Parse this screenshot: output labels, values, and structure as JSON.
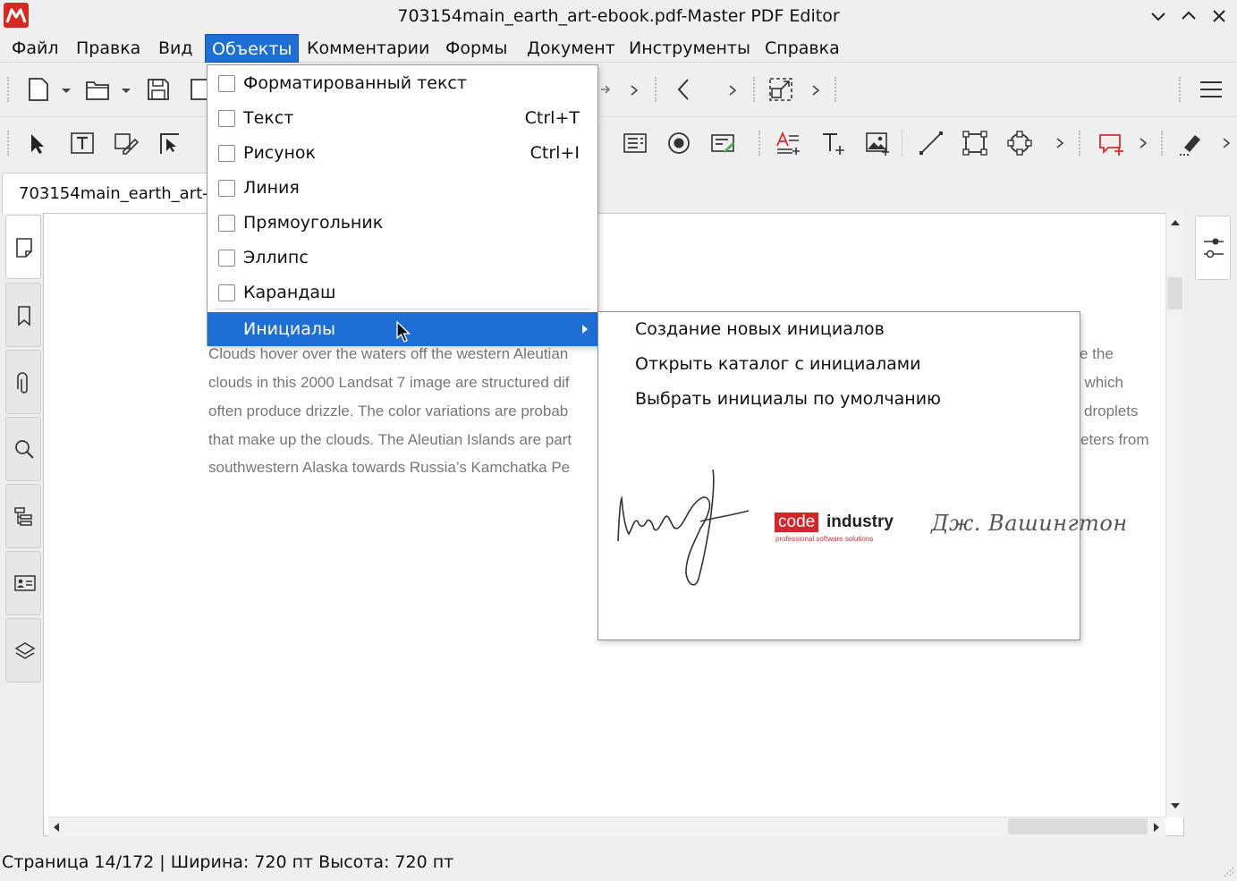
{
  "window": {
    "title": "703154main_earth_art-ebook.pdf-Master PDF Editor"
  },
  "menubar": {
    "items": [
      "Файл",
      "Правка",
      "Вид",
      "Объекты",
      "Комментарии",
      "Формы",
      "Документ",
      "Инструменты",
      "Справка"
    ],
    "active": "Объекты"
  },
  "tab": {
    "label": "703154main_earth_art-"
  },
  "objects_menu": {
    "items": [
      {
        "label": "Форматированный текст",
        "shortcut": ""
      },
      {
        "label": "Текст",
        "shortcut": "Ctrl+T"
      },
      {
        "label": "Рисунок",
        "shortcut": "Ctrl+I"
      },
      {
        "label": "Линия",
        "shortcut": ""
      },
      {
        "label": "Прямоугольник",
        "shortcut": ""
      },
      {
        "label": "Эллипс",
        "shortcut": ""
      },
      {
        "label": "Карандаш",
        "shortcut": ""
      }
    ],
    "highlighted": "Инициалы"
  },
  "initials_submenu": {
    "items": [
      "Создание новых инициалов",
      "Открыть каталог с инициалами",
      "Выбрать инициалы по умолчанию"
    ],
    "logo_code": "code",
    "logo_industry": "industry",
    "logo_tagline": "professional software solutions",
    "signature_text": "Дж. Вашингтон"
  },
  "document": {
    "lines_left": [
      "Clouds hover over the waters off the western Aleutian",
      "clouds in this 2000 Landsat 7 image are structured dif",
      "often produce drizzle. The color variations are probab",
      "that make up the clouds. The Aleutian Islands are part",
      "southwestern Alaska towards Russia’s Kamchatka Pe"
    ],
    "lines_right": [
      "e the",
      ", which",
      "droplets",
      "eters from"
    ]
  },
  "status": {
    "text": "Страница 14/172 | Ширина: 720 пт Высота: 720 пт"
  },
  "icons": [
    "app-logo-icon",
    "minimize-icon",
    "maximize-icon",
    "close-icon",
    "search-icon",
    "gear-icon",
    "hamburger-menu-icon"
  ],
  "colors": {
    "accent": "#1d6fd6",
    "brand_red": "#d2282b"
  }
}
